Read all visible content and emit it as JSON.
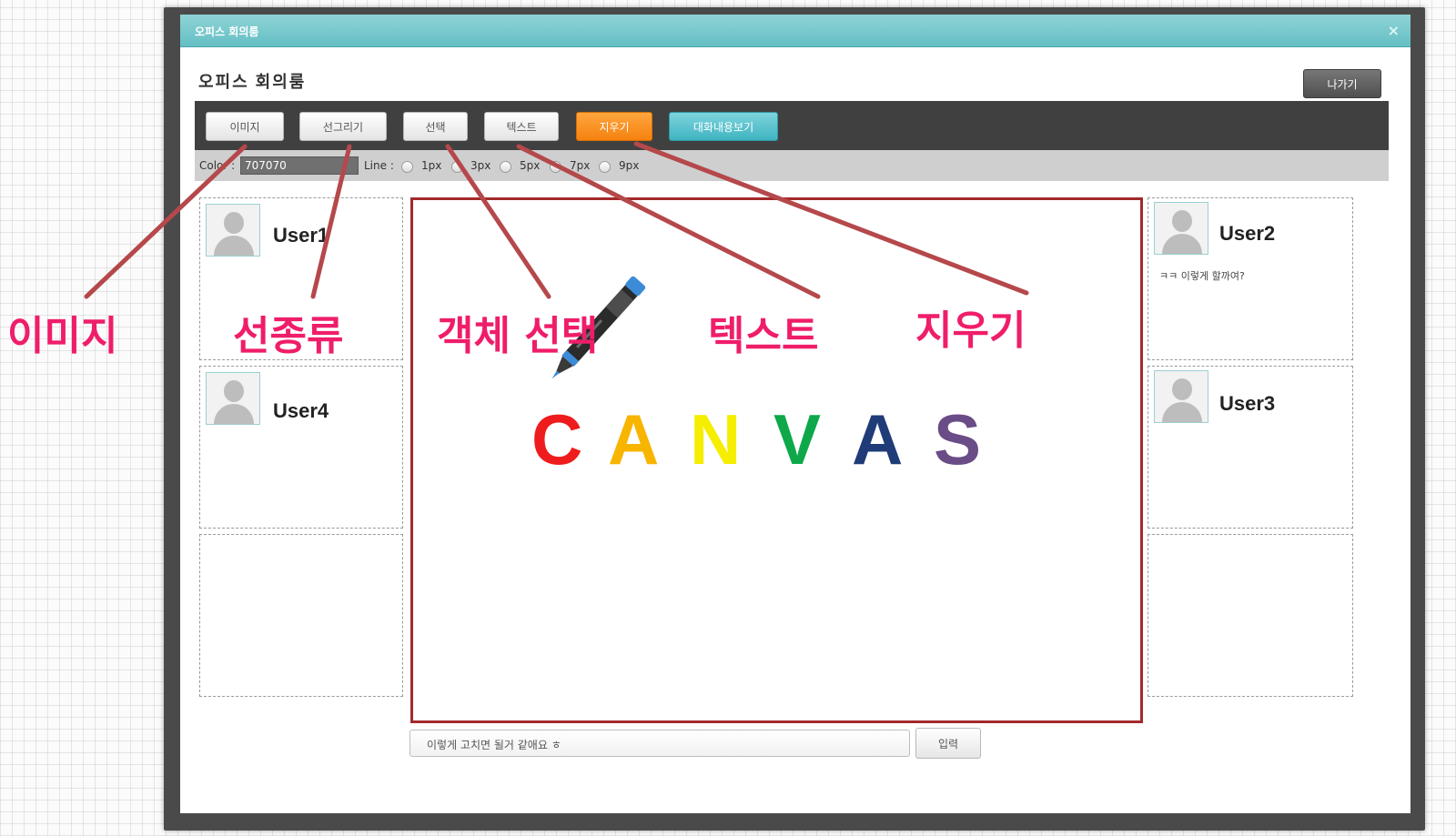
{
  "window": {
    "title": "오피스 회의룸",
    "close_label": "×",
    "room_title": "오피스 회의룸",
    "exit_label": "나가기"
  },
  "toolbar": {
    "buttons": [
      {
        "label": "이미지",
        "style": "default"
      },
      {
        "label": "선그리기",
        "style": "default"
      },
      {
        "label": "선택",
        "style": "default"
      },
      {
        "label": "텍스트",
        "style": "default"
      },
      {
        "label": "지우기",
        "style": "orange"
      },
      {
        "label": "대화내용보기",
        "style": "teal"
      }
    ]
  },
  "options": {
    "color_label": "Color :",
    "color_value": "707070",
    "line_label": "Line :",
    "line_sizes": [
      "1px",
      "3px",
      "5px",
      "7px",
      "9px"
    ]
  },
  "users": {
    "user1": {
      "name": "User1",
      "message": ""
    },
    "user2": {
      "name": "User2",
      "message": "ㅋㅋ 이렇게 할까여?"
    },
    "user3": {
      "name": "User3",
      "message": ""
    },
    "user4": {
      "name": "User4",
      "message": ""
    }
  },
  "canvas": {
    "letters": [
      {
        "char": "C",
        "color": "#ee1c1c"
      },
      {
        "char": "A",
        "color": "#f7b500"
      },
      {
        "char": "N",
        "color": "#f5ee00"
      },
      {
        "char": "V",
        "color": "#0ea84a"
      },
      {
        "char": "A",
        "color": "#203c78"
      },
      {
        "char": "S",
        "color": "#6a4c86"
      }
    ],
    "border_color": "#a22a2a"
  },
  "chat": {
    "input_value": "이렇게 고치면 될거 같애요 ㅎ",
    "enter_label": "입력"
  },
  "annotations": {
    "image": "이미지",
    "line_type": "선종류",
    "select": "객체 선택",
    "text": "텍스트",
    "erase": "지우기",
    "color": "#ef1d6a",
    "arrow_color": "#b5484b"
  },
  "icons": {
    "pen": "pen-icon",
    "avatar": "user-avatar-icon"
  }
}
